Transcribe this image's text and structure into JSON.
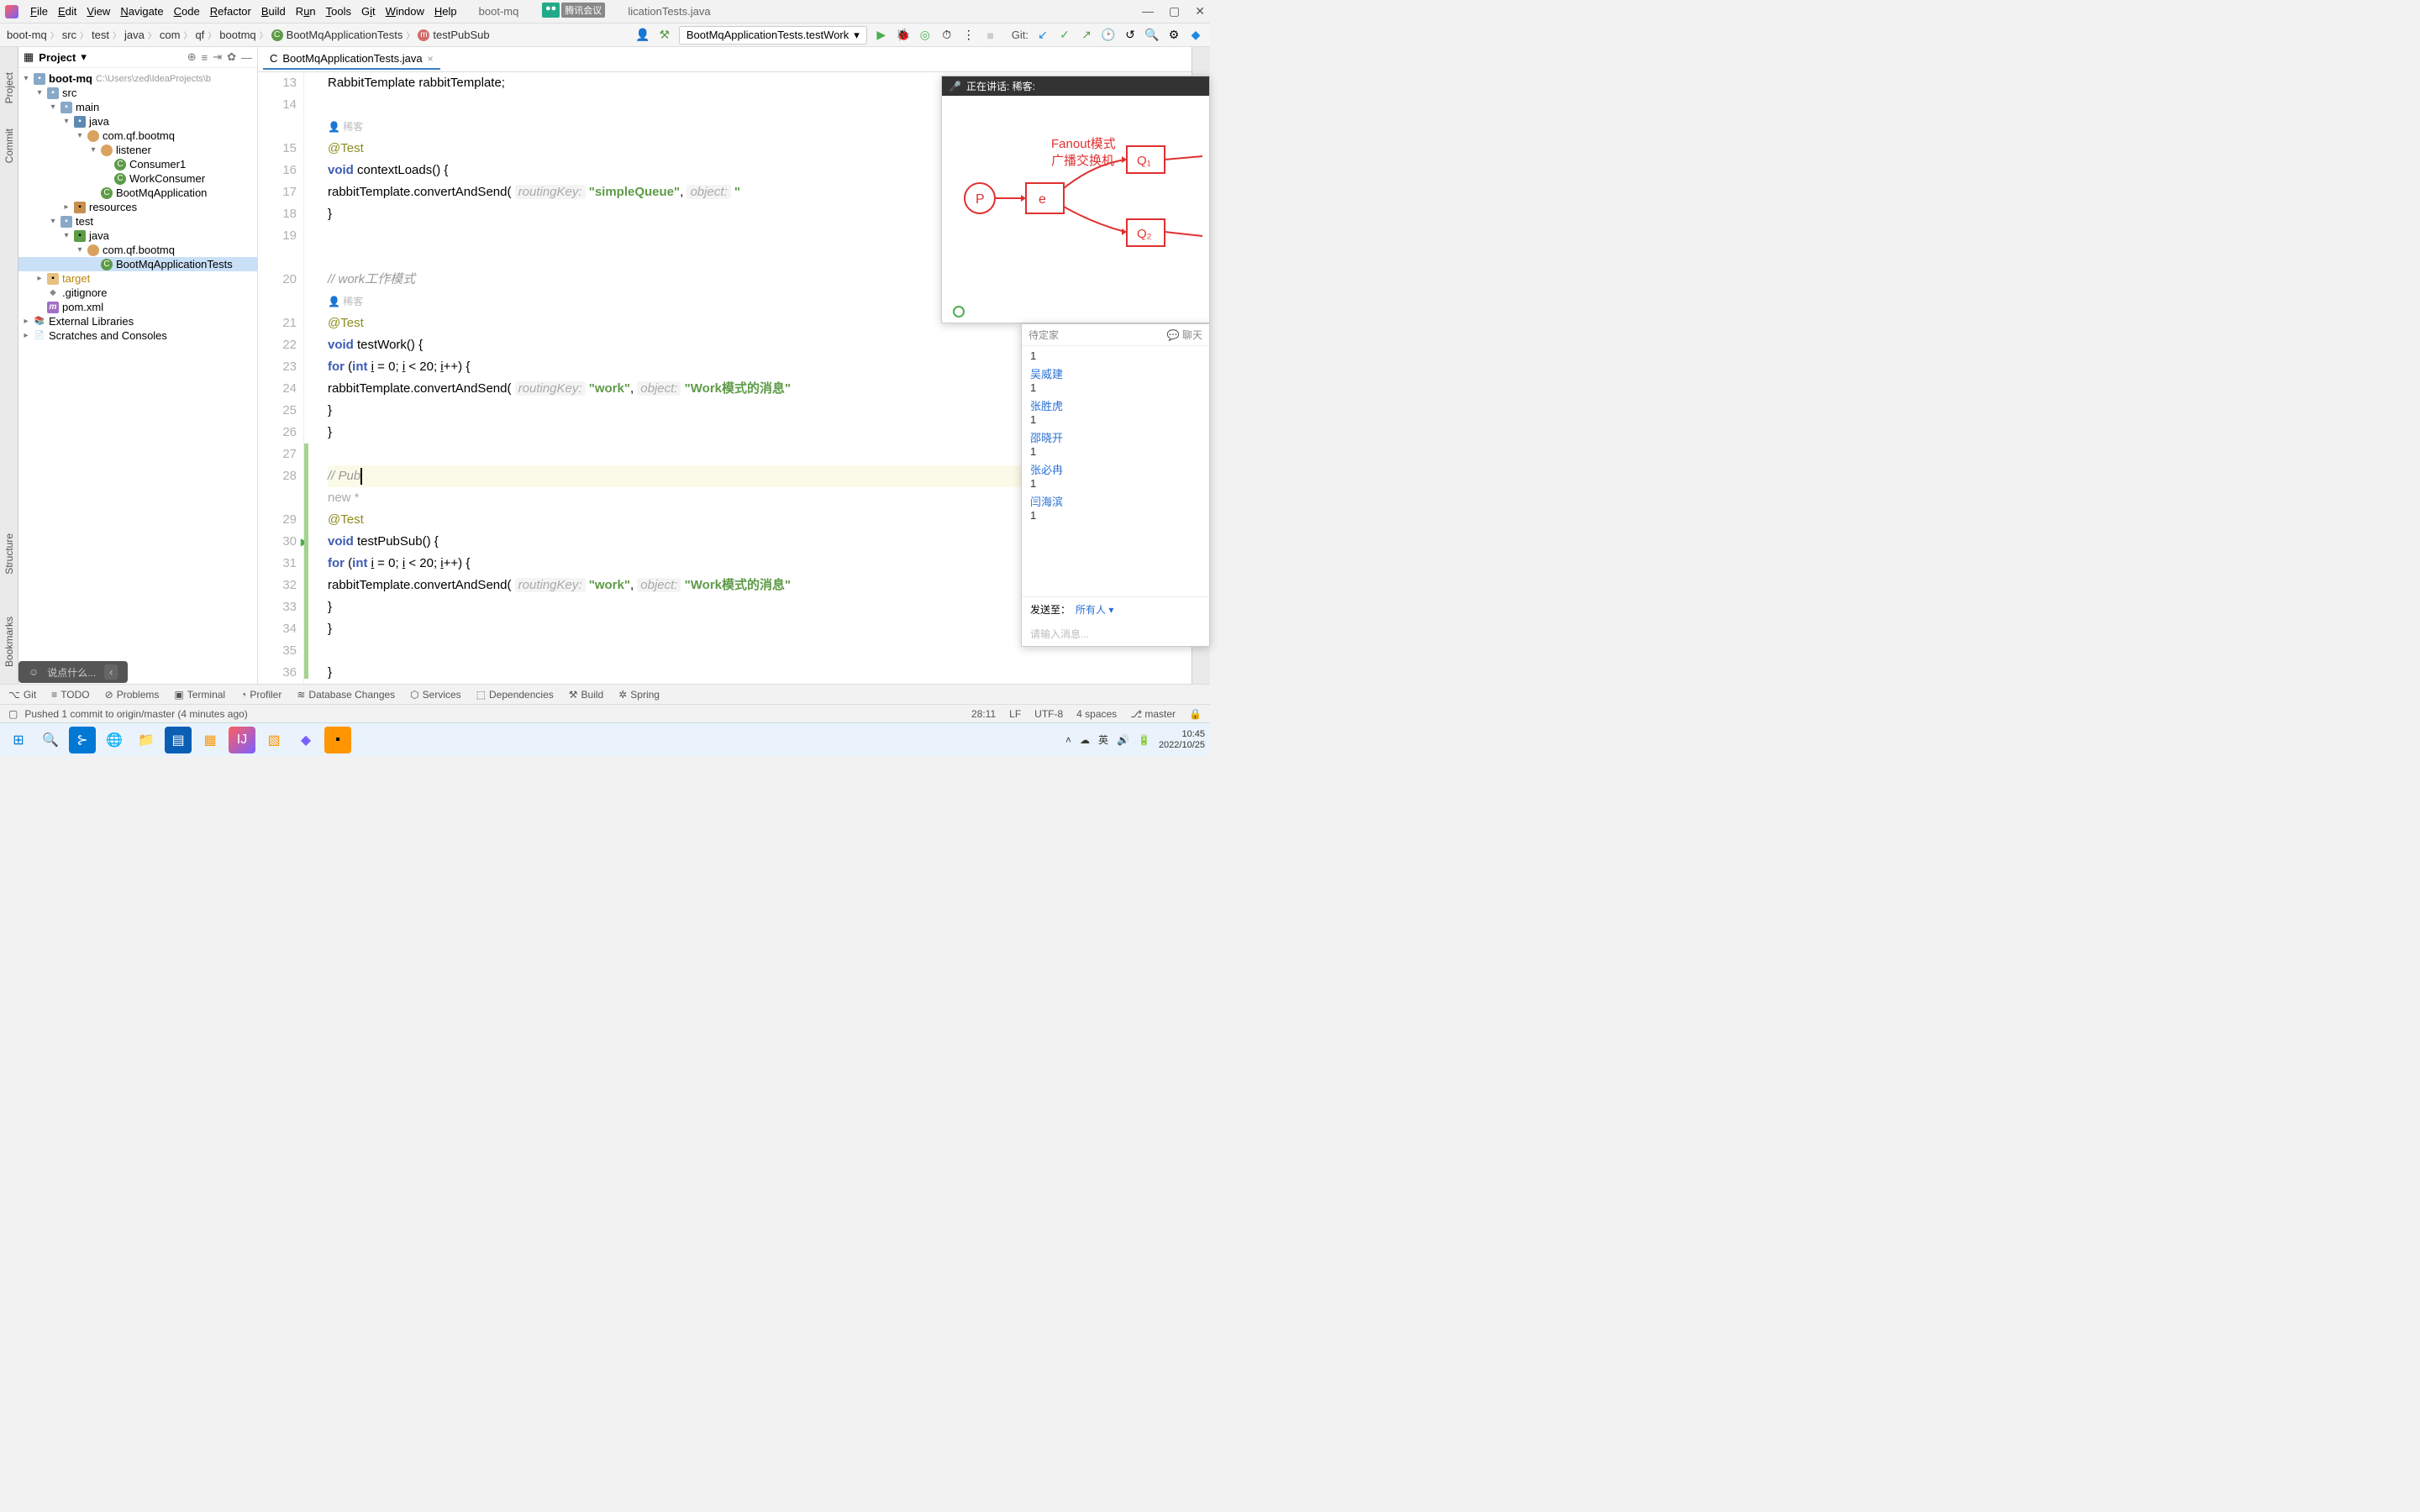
{
  "menubar": {
    "items": [
      "File",
      "Edit",
      "View",
      "Navigate",
      "Code",
      "Refactor",
      "Build",
      "Run",
      "Tools",
      "Git",
      "Window",
      "Help"
    ],
    "tab_prefix": "boot-mq",
    "tab_suffix": "licationTests.java",
    "overlay_tag1": "●●",
    "overlay_tag2": "腾讯会议"
  },
  "breadcrumbs": [
    "boot-mq",
    "src",
    "test",
    "java",
    "com",
    "qf",
    "bootmq",
    "BootMqApplicationTests",
    "testPubSub"
  ],
  "run_config": "BootMqApplicationTests.testWork",
  "git_label": "Git:",
  "project": {
    "title": "Project",
    "root": "boot-mq",
    "root_path": "C:\\Users\\zed\\IdeaProjects\\b",
    "src": "src",
    "main": "main",
    "java": "java",
    "pkg": "com.qf.bootmq",
    "listener": "listener",
    "consumer1": "Consumer1",
    "workconsumer": "WorkConsumer",
    "bootapp": "BootMqApplication",
    "resources": "resources",
    "test": "test",
    "java2": "java",
    "pkg2": "com.qf.bootmq",
    "testclass": "BootMqApplicationTests",
    "target": "target",
    "gitignore": ".gitignore",
    "pom": "pom.xml",
    "ext_lib": "External Libraries",
    "scratches": "Scratches and Consoles"
  },
  "editor_tab": "BootMqApplicationTests.java",
  "code": {
    "l13": {
      "a": "RabbitTemplate ",
      "b": "rabbitTemplate",
      "c": ";"
    },
    "author1": "稀客",
    "l15": "@Test",
    "l16": {
      "a": "void ",
      "b": "contextLoads",
      "c": "() {"
    },
    "l17": {
      "a": "rabbitTemplate.convertAndSend(",
      "h1": "routingKey:",
      "s1": "\"simpleQueue\"",
      "c1": ",",
      "h2": "object:",
      "s2": "\""
    },
    "l18": "}",
    "cmt1": "// work工作模式",
    "author2": "稀客",
    "l21": "@Test",
    "l22": {
      "a": "void ",
      "b": "testWork",
      "c": "() {"
    },
    "l23": {
      "a": "for ",
      "b": "(",
      "c": "int ",
      "d": "i",
      "e": " = ",
      "f": "0",
      "g": "; ",
      "h": "i",
      "i": " < ",
      "j": "20",
      "k": "; ",
      "l": "i",
      "m": "++) {"
    },
    "l24": {
      "a": "rabbitTemplate.convertAndSend(",
      "h1": "routingKey:",
      "s1": "\"work\"",
      "c1": ",",
      "h2": "object:",
      "s2": "\"Work模式的消息\""
    },
    "l25": "}",
    "l26": "}",
    "cmt2": "// Pub",
    "new_star": "new *",
    "l29": "@Test",
    "l30": {
      "a": "void ",
      "b": "testPubSub",
      "c": "() {"
    },
    "l31": {
      "a": "for ",
      "b": "(",
      "c": "int ",
      "d": "i",
      "e": " = ",
      "f": "0",
      "g": "; ",
      "h": "i",
      "i": " < ",
      "j": "20",
      "k": "; ",
      "l": "i",
      "m": "++) {"
    },
    "l32": {
      "a": "rabbitTemplate.convertAndSend(",
      "h1": "routingKey:",
      "s1": "\"work\"",
      "c1": ",",
      "h2": "object:",
      "s2": "\"Work模式的消息\""
    },
    "l33": "}",
    "l34": "}",
    "l36": "}"
  },
  "line_numbers": [
    "13",
    "14",
    "",
    "15",
    "16",
    "17",
    "18",
    "19",
    "",
    "20",
    "",
    "21",
    "22",
    "23",
    "24",
    "25",
    "26",
    "27",
    "28",
    "",
    "29",
    "30",
    "31",
    "32",
    "33",
    "34",
    "35",
    "36"
  ],
  "meeting": {
    "speaker_label": "正在讲话: 稀客:",
    "diagram_title1": "Fanout模式",
    "diagram_title2": "广播交换机",
    "chat_tab": "聊天",
    "host": "待定家",
    "names": [
      "吴威建",
      "张胜虎",
      "邵晓开",
      "张必冉",
      "闫海滨"
    ],
    "msg": "1",
    "send_to_label": "发送至：",
    "send_to_value": "所有人",
    "placeholder": "请输入消息..."
  },
  "assist_placeholder": "说点什么...",
  "toolwindows": [
    "Git",
    "TODO",
    "Problems",
    "Terminal",
    "Profiler",
    "Database Changes",
    "Services",
    "Dependencies",
    "Build",
    "Spring"
  ],
  "status": {
    "msg": "Pushed 1 commit to origin/master (4 minutes ago)",
    "pos": "28:11",
    "sep": "LF",
    "enc": "UTF-8",
    "indent": "4 spaces",
    "branch": "master"
  },
  "taskbar": {
    "time": "10:45",
    "date": "2022/10/25",
    "ime": "英",
    "sys_icons": [
      "˄",
      "☁",
      "🔊",
      "🔋"
    ]
  },
  "sidebar_left": [
    "Project",
    "Commit",
    "Bookmarks",
    "Structure"
  ]
}
